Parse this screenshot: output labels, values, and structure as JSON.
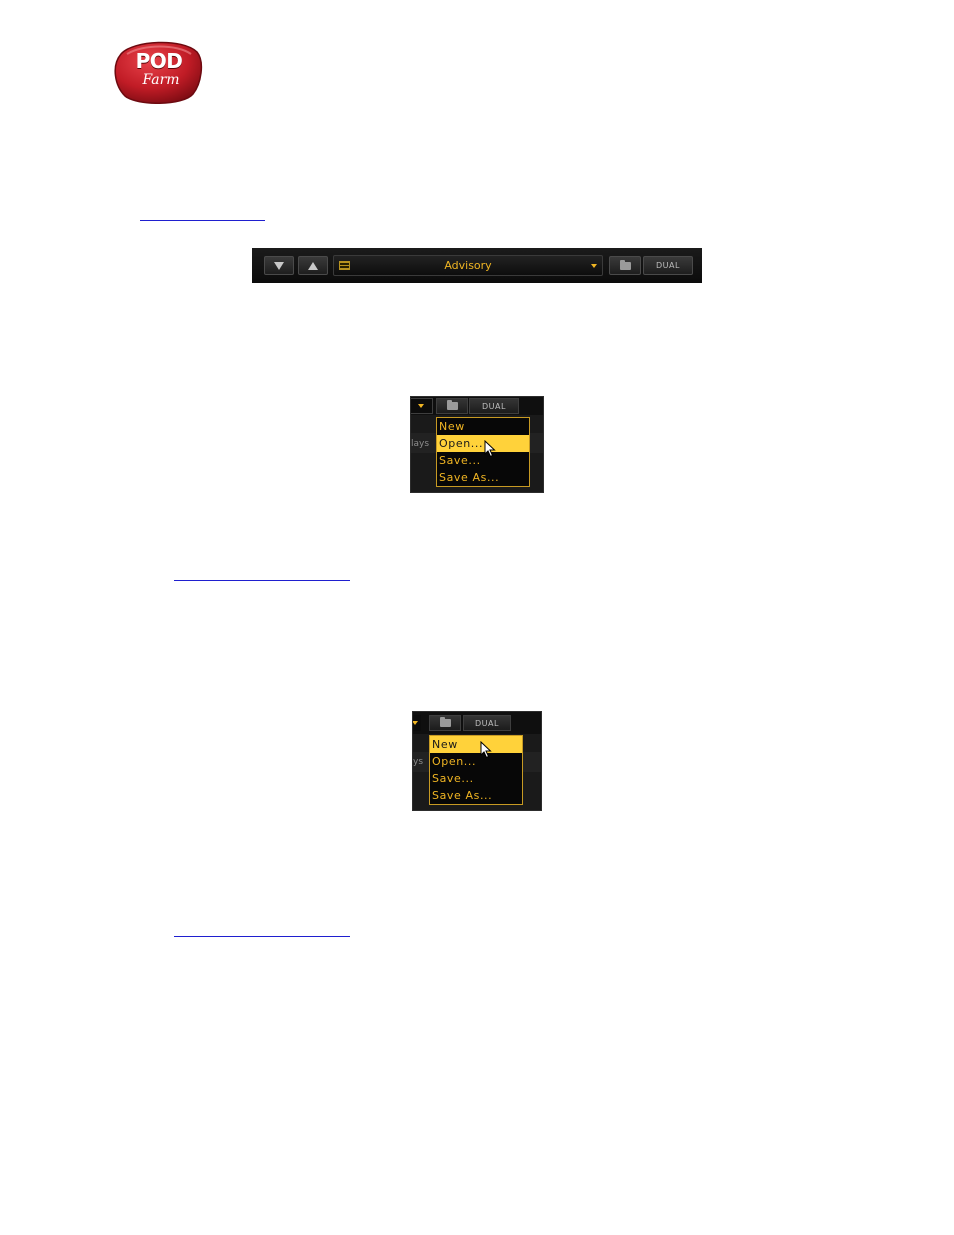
{
  "brand": {
    "logo_text_top": "POD",
    "logo_text_bottom": "Farm",
    "color": "#c8202a"
  },
  "toolbar": {
    "preset_name": "Advisory",
    "dual_label": "DUAL",
    "accent": "#f0b523"
  },
  "menu_open": {
    "dual_label": "DUAL",
    "side_text": "lays",
    "items": [
      "New",
      "Open...",
      "Save...",
      "Save As..."
    ],
    "highlighted": "Open..."
  },
  "menu_new": {
    "dual_label": "DUAL",
    "side_text": "ys",
    "items": [
      "New",
      "Open...",
      "Save...",
      "Save As..."
    ],
    "highlighted": "New"
  }
}
